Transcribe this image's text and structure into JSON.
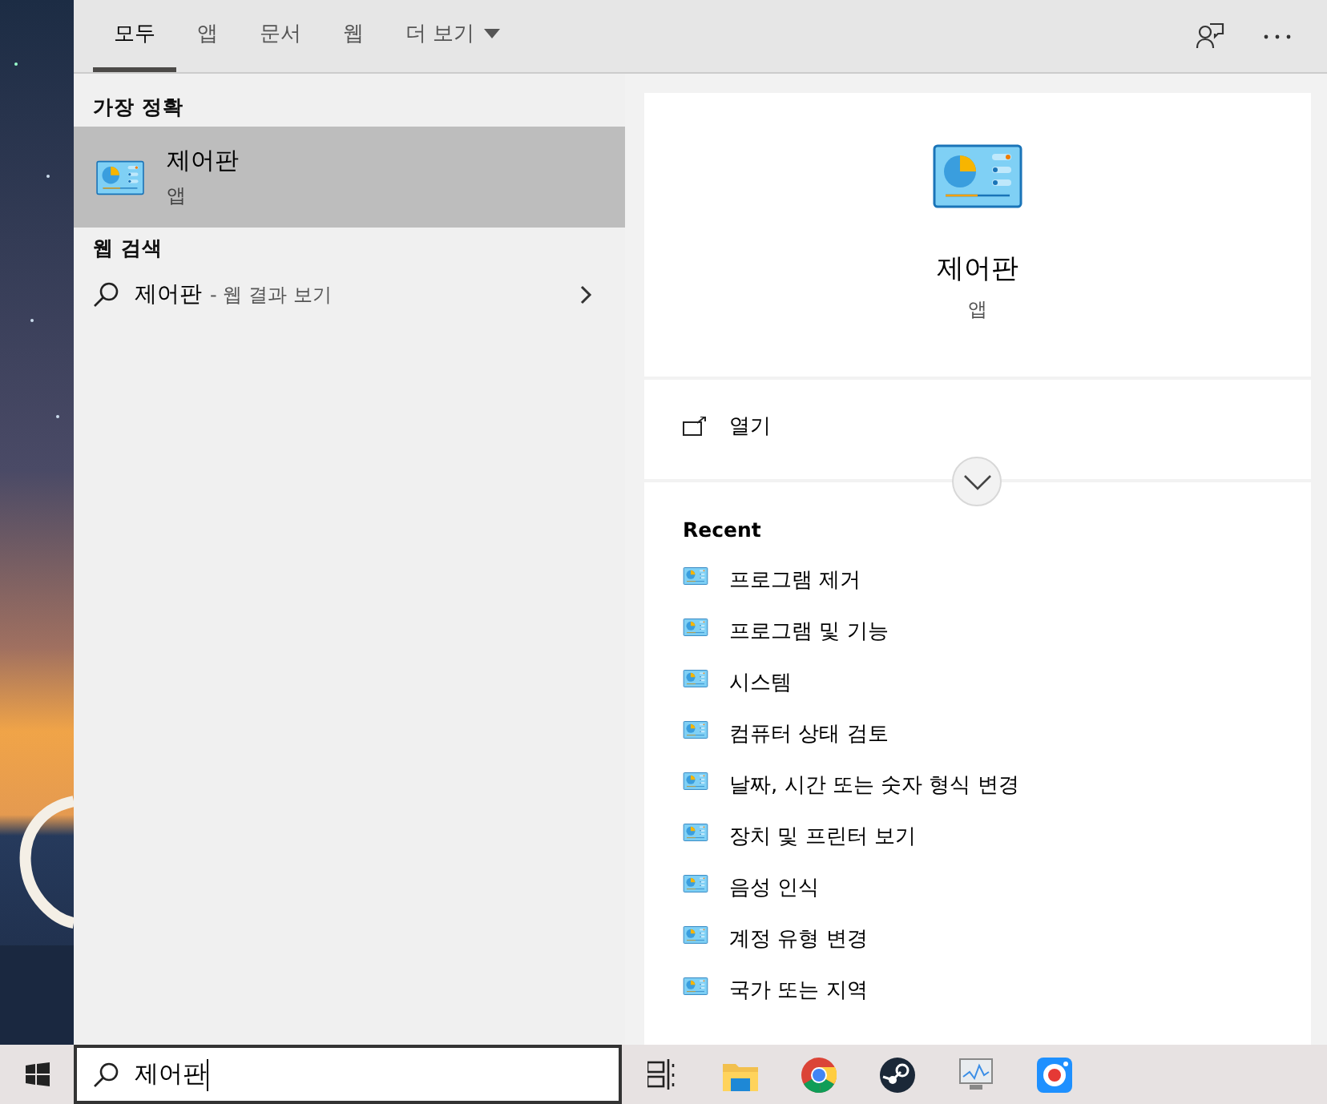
{
  "tabs": [
    {
      "label": "모두",
      "selected": true,
      "kind": "plain"
    },
    {
      "label": "앱",
      "selected": false,
      "kind": "plain"
    },
    {
      "label": "문서",
      "selected": false,
      "kind": "plain"
    },
    {
      "label": "웹",
      "selected": false,
      "kind": "plain"
    },
    {
      "label": "더 보기",
      "selected": false,
      "kind": "dropdown"
    }
  ],
  "results": {
    "best_match": {
      "heading": "가장 정확",
      "item": {
        "title": "제어판",
        "subtitle": "앱",
        "selected": true
      }
    },
    "web_search": {
      "heading": "웹 검색",
      "item": {
        "query": "제어판",
        "hint": "- 웹 결과 보기"
      }
    }
  },
  "detail": {
    "title": "제어판",
    "subtitle": "앱",
    "actions": [
      {
        "label": "열기"
      }
    ],
    "recent": {
      "heading": "Recent",
      "items": [
        {
          "label": "프로그램 제거"
        },
        {
          "label": "프로그램 및 기능"
        },
        {
          "label": "시스템"
        },
        {
          "label": "컴퓨터 상태 검토"
        },
        {
          "label": "날짜, 시간 또는 숫자 형식 변경"
        },
        {
          "label": "장치 및 프린터 보기"
        },
        {
          "label": "음성 인식"
        },
        {
          "label": "계정 유형 변경"
        },
        {
          "label": "국가 또는 지역"
        }
      ]
    }
  },
  "taskbar": {
    "search": {
      "value": "제어판"
    },
    "apps": [
      {
        "kind": "task-view"
      },
      {
        "kind": "folder"
      },
      {
        "kind": "browser"
      },
      {
        "kind": "steam"
      },
      {
        "kind": "monitor"
      },
      {
        "kind": "recorder"
      }
    ]
  }
}
